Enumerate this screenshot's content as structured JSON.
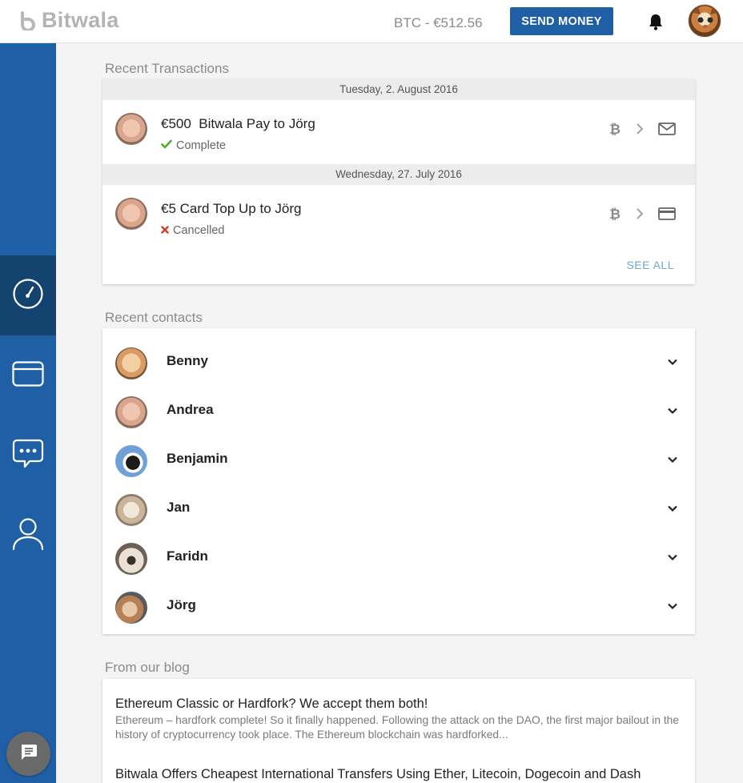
{
  "header": {
    "logo_text": "Bitwala",
    "btc_price": "BTC - €512.56",
    "send_money_label": "SEND MONEY"
  },
  "sidebar": {
    "items": [
      {
        "name": "dashboard",
        "icon": "gauge-icon",
        "active": true
      },
      {
        "name": "card",
        "icon": "credit-card-icon",
        "active": false
      },
      {
        "name": "messages",
        "icon": "chat-bubble-icon",
        "active": false
      },
      {
        "name": "profile",
        "icon": "user-icon",
        "active": false
      }
    ]
  },
  "transactions": {
    "section_title": "Recent Transactions",
    "groups": [
      {
        "date": "Tuesday, 2. August 2016",
        "items": [
          {
            "title": "€500  Bitwala Pay to Jörg",
            "status": "Complete",
            "status_type": "complete",
            "method_icon": "envelope-icon"
          }
        ]
      },
      {
        "date": "Wednesday, 27. July 2016",
        "items": [
          {
            "title": "€5 Card Top Up to Jörg",
            "status": "Cancelled",
            "status_type": "cancelled",
            "method_icon": "credit-card-icon"
          }
        ]
      }
    ],
    "see_all_label": "SEE ALL"
  },
  "contacts": {
    "section_title": "Recent contacts",
    "items": [
      {
        "name": "Benny",
        "avatar": "baby2"
      },
      {
        "name": "Andrea",
        "avatar": "baby"
      },
      {
        "name": "Benjamin",
        "avatar": "penguin"
      },
      {
        "name": "Jan",
        "avatar": "dog"
      },
      {
        "name": "Faridn",
        "avatar": "dog2"
      },
      {
        "name": "Jörg",
        "avatar": "hamster"
      }
    ]
  },
  "blog": {
    "section_title": "From our blog",
    "posts": [
      {
        "title": "Ethereum Classic or Hardfork? We accept them both!",
        "excerpt": "Ethereum – hardfork complete! So it finally happened. Following the attack on the DAO, the first major bailout in the history of cryptocurrency took place. The Ethereum blockchain was hardforked..."
      },
      {
        "title": "Bitwala Offers Cheapest International Transfers Using Ether, Litecoin, Dogecoin and Dash",
        "excerpt": ""
      }
    ]
  },
  "colors": {
    "brand_blue": "#1f5fa6",
    "sidebar_active": "#15436f",
    "complete_green": "#4caf2a",
    "cancelled_red": "#d33a2c",
    "link_blue": "#6fa6d0"
  }
}
